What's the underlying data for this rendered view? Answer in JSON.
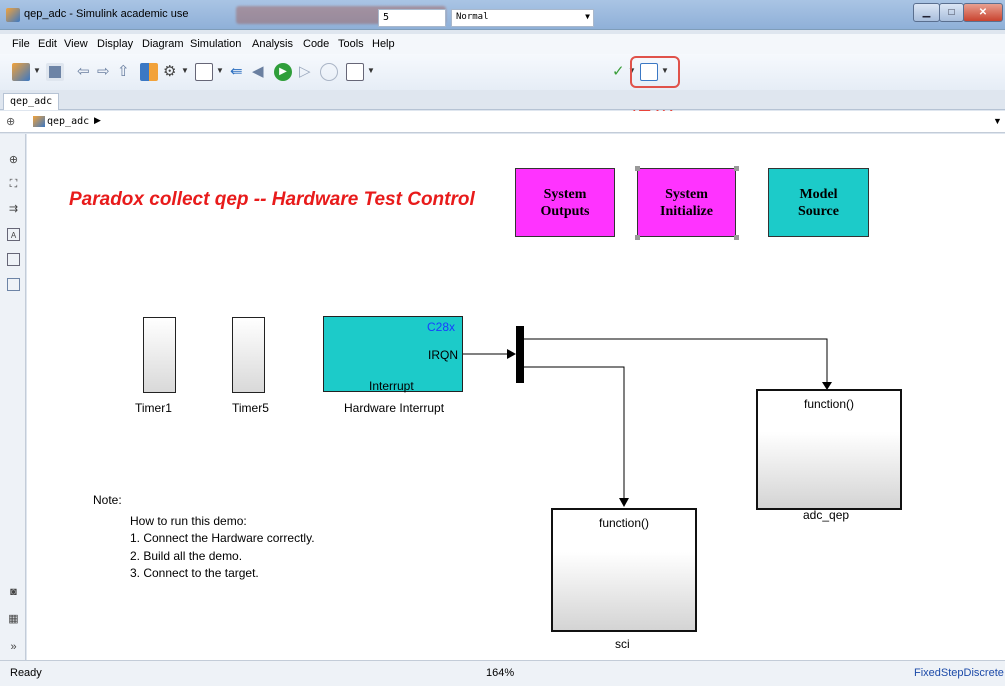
{
  "window": {
    "title": "qep_adc - Simulink academic use"
  },
  "menu": [
    "File",
    "Edit",
    "View",
    "Display",
    "Diagram",
    "Simulation",
    "Analysis",
    "Code",
    "Tools",
    "Help"
  ],
  "toolbar": {
    "stop_time": "5",
    "sim_mode": "Normal"
  },
  "annotation": {
    "build_label": "编译"
  },
  "tabs": [
    {
      "label": "qep_adc"
    }
  ],
  "breadcrumb": {
    "model": "qep_adc"
  },
  "diagram": {
    "title": "Paradox collect qep -- Hardware Test Control",
    "subsystems": [
      {
        "line1": "System",
        "line2": "Outputs"
      },
      {
        "line1": "System",
        "line2": "Initialize"
      },
      {
        "line1": "Model",
        "line2": "Source"
      }
    ],
    "timers": [
      "Timer1",
      "Timer5"
    ],
    "hw_interrupt": {
      "target": "C28x",
      "port": "IRQN",
      "inner_label": "Interrupt",
      "label": "Hardware Interrupt"
    },
    "function_calls": [
      {
        "port": "function()",
        "label": "adc_qep"
      },
      {
        "port": "function()",
        "label": "sci"
      }
    ],
    "note": {
      "heading": "Note:",
      "intro": "How to run this demo:",
      "steps": [
        "1.  Connect the Hardware correctly.",
        "2.  Build all the demo.",
        "3.  Connect to the target."
      ]
    }
  },
  "status": {
    "ready": "Ready",
    "zoom": "164%",
    "solver": "FixedStepDiscrete"
  }
}
